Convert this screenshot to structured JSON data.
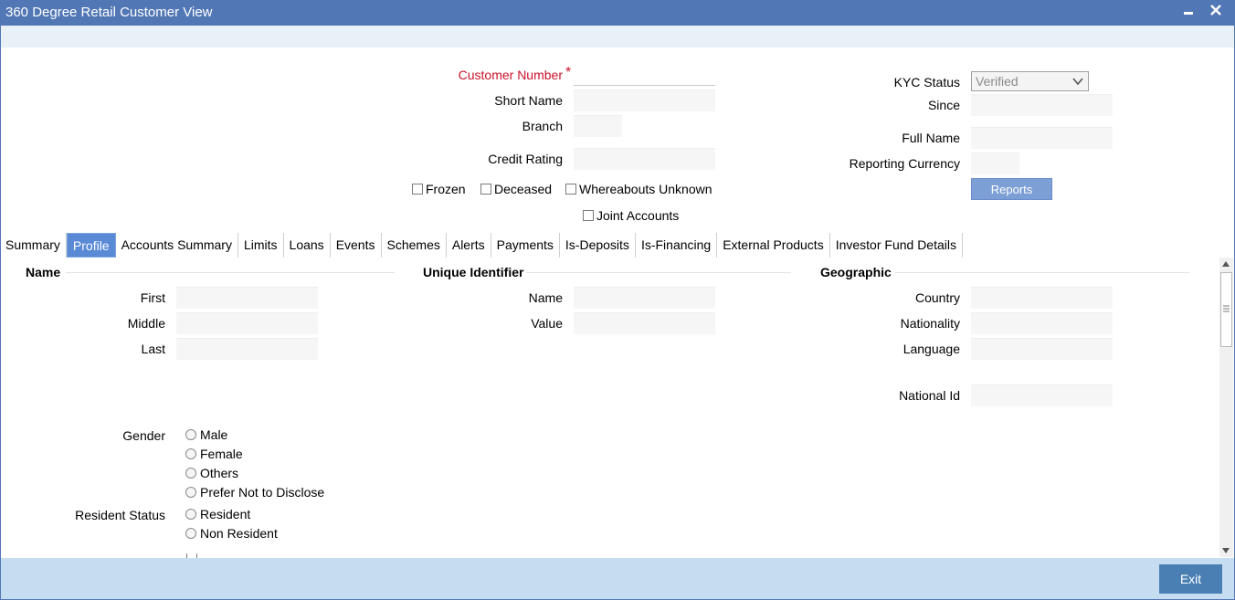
{
  "window": {
    "title": "360 Degree Retail Customer View",
    "minimize_icon": "minimize-icon",
    "close_icon": "close-icon"
  },
  "header": {
    "customer_number_label": "Customer Number",
    "required_mark": "*",
    "short_name_label": "Short Name",
    "branch_label": "Branch",
    "credit_rating_label": "Credit Rating",
    "kyc_status_label": "KYC Status",
    "kyc_status_value": "Verified",
    "since_label": "Since",
    "full_name_label": "Full Name",
    "reporting_currency_label": "Reporting Currency",
    "reports_button": "Reports",
    "frozen_label": "Frozen",
    "deceased_label": "Deceased",
    "whereabouts_label": "Whereabouts Unknown",
    "joint_accounts_label": "Joint Accounts"
  },
  "tabs": [
    {
      "label": "Summary"
    },
    {
      "label": "Profile",
      "active": true
    },
    {
      "label": "Accounts Summary"
    },
    {
      "label": "Limits"
    },
    {
      "label": "Loans"
    },
    {
      "label": "Events"
    },
    {
      "label": "Schemes"
    },
    {
      "label": "Alerts"
    },
    {
      "label": "Payments"
    },
    {
      "label": "Is-Deposits"
    },
    {
      "label": "Is-Financing"
    },
    {
      "label": "External Products"
    },
    {
      "label": "Investor Fund Details"
    }
  ],
  "profile": {
    "name_section": "Name",
    "first_label": "First",
    "middle_label": "Middle",
    "last_label": "Last",
    "unique_section": "Unique Identifier",
    "uid_name_label": "Name",
    "uid_value_label": "Value",
    "geo_section": "Geographic",
    "country_label": "Country",
    "nationality_label": "Nationality",
    "language_label": "Language",
    "national_id_label": "National Id",
    "gender_label": "Gender",
    "gender_options": [
      "Male",
      "Female",
      "Others",
      "Prefer Not to Disclose"
    ],
    "resident_status_label": "Resident Status",
    "resident_options": [
      "Resident",
      "Non Resident"
    ]
  },
  "footer": {
    "exit_button": "Exit"
  },
  "colors": {
    "titlebar": "#5277b5",
    "active_tab": "#5a8ad6",
    "footer": "#c6dcf1",
    "exit_button": "#4a7fb3",
    "required": "#c9132b"
  }
}
